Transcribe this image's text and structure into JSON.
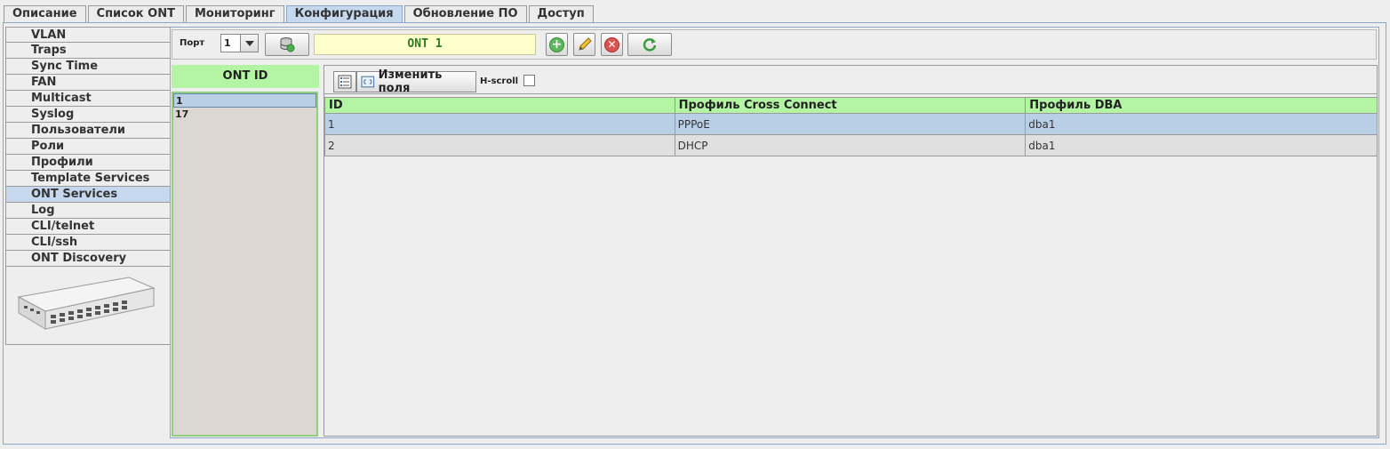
{
  "tabs": [
    "Описание",
    "Список ONT",
    "Мониторинг",
    "Конфигурация",
    "Обновление ПО",
    "Доступ"
  ],
  "active_tab": "Конфигурация",
  "menu": {
    "items": [
      "VLAN",
      "Traps",
      "Sync Time",
      "FAN",
      "Multicast",
      "Syslog",
      "Пользователи",
      "Роли",
      "Профили",
      "Template Services",
      "ONT Services",
      "Log",
      "CLI/telnet",
      "CLI/ssh",
      "ONT Discovery"
    ],
    "active": "ONT Services"
  },
  "toolbar": {
    "port_label": "Порт",
    "port_value": "1",
    "ont_field": "ONT 1"
  },
  "ontid": {
    "header": "ONT ID",
    "items": [
      "1",
      "17"
    ]
  },
  "table": {
    "edit_fields_label": "Изменить поля",
    "hscroll_label": "H-scroll",
    "columns": [
      "ID",
      "Профиль Cross Connect",
      "Профиль DBA"
    ],
    "rows": [
      [
        "1",
        "PPPoE",
        "dba1"
      ],
      [
        "2",
        "DHCP",
        "dba1"
      ]
    ]
  },
  "colors": {
    "header_green": "#b3f5a3",
    "selection_blue": "#b8cfe6",
    "ont_field_bg": "#ffffcc",
    "add_green": "#5cb85c",
    "delete_red": "#d9534f"
  },
  "icons": {
    "port_refresh": "database-refresh-icon",
    "add": "add-circle-icon",
    "edit": "pencil-icon",
    "delete": "delete-circle-icon",
    "refresh": "refresh-icon",
    "columns": "column-list-icon",
    "edit_fields": "fields-icon"
  }
}
